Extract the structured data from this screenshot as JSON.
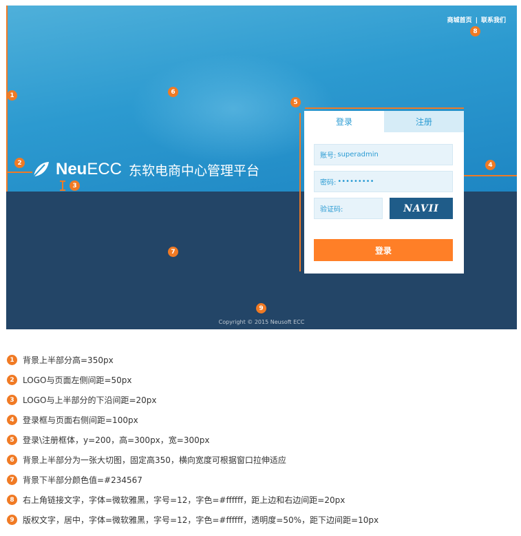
{
  "header": {
    "links": [
      "商城首页",
      "联系我们"
    ],
    "separator": "|"
  },
  "logo": {
    "brand_bold": "Neu",
    "brand_light": "ECC",
    "subtitle": "东软电商中心管理平台"
  },
  "login": {
    "tabs": [
      "登录",
      "注册"
    ],
    "account_label": "账号:",
    "account_value": "superadmin",
    "password_label": "密码:",
    "password_value": "•••••••••",
    "captcha_label": "验证码:",
    "captcha_text": "NAVII",
    "submit_label": "登录"
  },
  "footer": {
    "copyright": "Copyright © 2015 Neusoft ECC"
  },
  "markers": [
    "1",
    "2",
    "3",
    "4",
    "5",
    "6",
    "7",
    "8",
    "9"
  ],
  "notes": [
    {
      "n": "1",
      "text": "背景上半部分高=350px"
    },
    {
      "n": "2",
      "text": "LOGO与页面左侧间距=50px"
    },
    {
      "n": "3",
      "text": "LOGO与上半部分的下沿间距=20px"
    },
    {
      "n": "4",
      "text": "登录框与页面右侧间距=100px"
    },
    {
      "n": "5",
      "text": "登录\\注册框体，y=200，高=300px，宽=300px"
    },
    {
      "n": "6",
      "text": "背景上半部分为一张大切图，固定高350，横向宽度可根据窗口拉伸适应"
    },
    {
      "n": "7",
      "text": "背景下半部分颜色值=#234567"
    },
    {
      "n": "8",
      "text": "右上角链接文字，字体=微软雅黑，字号=12，字色=#ffffff，距上边和右边间距=20px"
    },
    {
      "n": "9",
      "text": "版权文字，居中，字体=微软雅黑，字号=12，字色=#ffffff，透明度=50%，距下边间距=10px"
    }
  ],
  "colors": {
    "accent": "#f07a24",
    "bottom_bg": "#234567",
    "button": "#ff7f27",
    "tab": "#2a9bd3"
  }
}
